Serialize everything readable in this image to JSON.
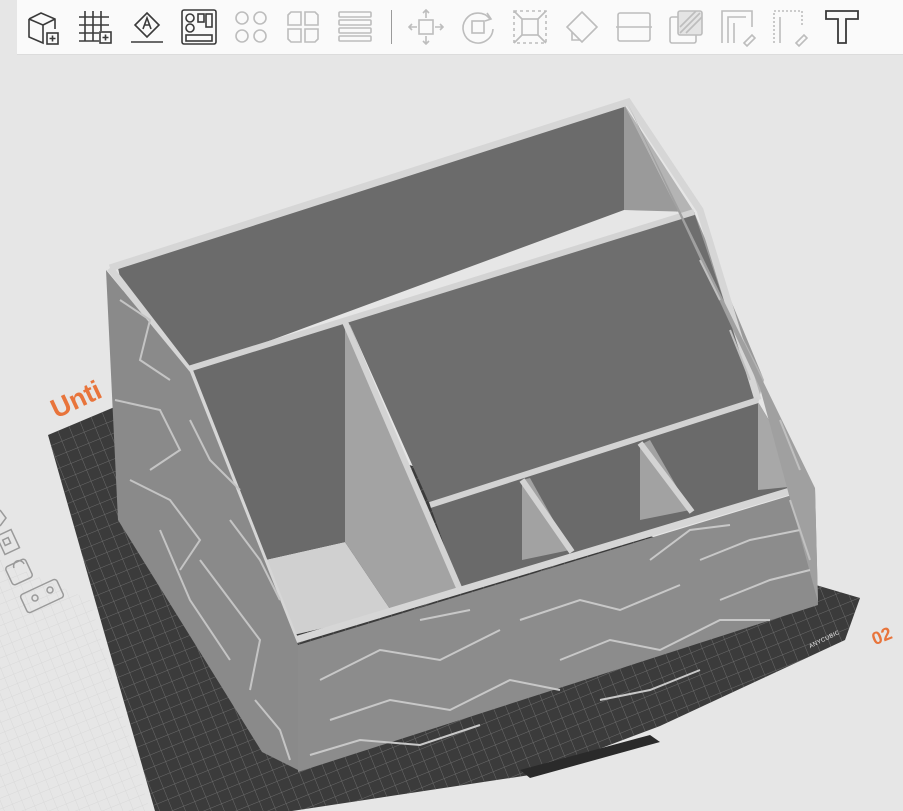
{
  "toolbar": {
    "items": [
      {
        "icon": "add-object-icon",
        "enabled": true
      },
      {
        "icon": "add-grid-icon",
        "enabled": true
      },
      {
        "icon": "auto-orient-icon",
        "enabled": true
      },
      {
        "icon": "arrange-icon",
        "enabled": true
      },
      {
        "icon": "split-objects-icon",
        "enabled": false
      },
      {
        "icon": "split-parts-icon",
        "enabled": false
      },
      {
        "icon": "layers-icon",
        "enabled": false
      },
      {
        "icon": "move-icon",
        "enabled": false
      },
      {
        "icon": "rotate-icon",
        "enabled": false
      },
      {
        "icon": "scale-icon",
        "enabled": false
      },
      {
        "icon": "lay-on-face-icon",
        "enabled": false
      },
      {
        "icon": "cut-icon",
        "enabled": false
      },
      {
        "icon": "support-paint-icon",
        "enabled": false
      },
      {
        "icon": "seam-paint-icon",
        "enabled": false
      },
      {
        "icon": "fuzzy-paint-icon",
        "enabled": false
      },
      {
        "icon": "text-icon",
        "enabled": true
      }
    ],
    "colors": {
      "enabled": "#3a3a3a",
      "disabled": "#bdbdbd"
    }
  },
  "plate": {
    "name_label": "Unti",
    "number": "02",
    "brand": "ANYCUBIC",
    "accent_color": "#e8743b"
  },
  "side_icons": [
    "select-plate-icon",
    "plate-settings-icon",
    "lock-icon",
    "plate-options-icon"
  ]
}
